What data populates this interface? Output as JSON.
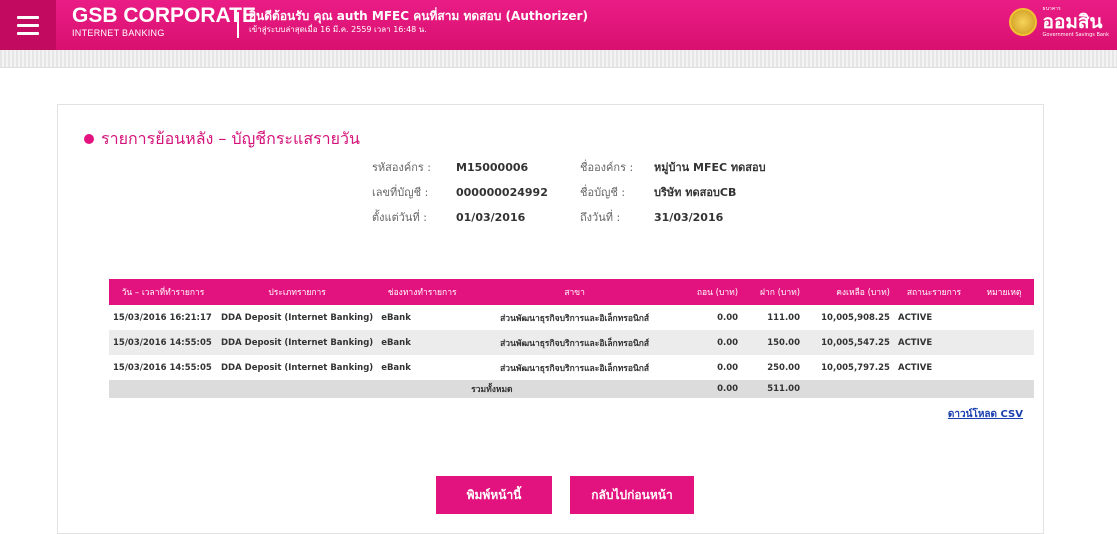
{
  "header": {
    "brand_main": "GSB CORPORATE",
    "brand_sub": "INTERNET BANKING",
    "welcome": "ยินดีต้อนรับ คุณ auth MFEC คนที่สาม ทดสอบ (Authorizer)",
    "last_login": "เข้าสู่ระบบล่าสุดเมื่อ 16 มี.ค. 2559 เวลา 16:48 น.",
    "bank_name": "ออมสิน",
    "bank_small_top": "ธนาคาร",
    "bank_small_bottom": "Government Savings Bank",
    "menu_icon": "hamburger-icon",
    "accent_color": "#e2127f"
  },
  "page": {
    "title": "รายการย้อนหลัง – บัญชีกระแสรายวัน"
  },
  "info": {
    "org_code_label": "รหัสองค์กร :",
    "org_code_value": "M15000006",
    "org_name_label": "ชื่อองค์กร :",
    "org_name_value": "หมู่บ้าน MFEC ทดสอบ",
    "account_no_label": "เลขที่บัญชี :",
    "account_no_value": "000000024992",
    "account_name_label": "ชื่อบัญชี :",
    "account_name_value": "บริษัท ทดสอบCB",
    "from_label": "ตั้งแต่วันที่ :",
    "from_value": "01/03/2016",
    "to_label": "ถึงวันที่ :",
    "to_value": "31/03/2016"
  },
  "table": {
    "headers": [
      "วัน – เวลาที่ทำรายการ",
      "ประเภทรายการ",
      "ช่องทางทำรายการ",
      "สาขา",
      "ถอน (บาท)",
      "ฝาก (บาท)",
      "คงเหลือ (บาท)",
      "สถานะรายการ",
      "หมายเหตุ"
    ],
    "rows": [
      [
        "15/03/2016 16:21:17",
        "DDA Deposit (Internet Banking)",
        "eBank",
        "ส่วนพัฒนาธุรกิจบริการและอิเล็กทรอนิกส์",
        "0.00",
        "111.00",
        "10,005,908.25",
        "ACTIVE",
        ""
      ],
      [
        "15/03/2016 14:55:05",
        "DDA Deposit (Internet Banking)",
        "eBank",
        "ส่วนพัฒนาธุรกิจบริการและอิเล็กทรอนิกส์",
        "0.00",
        "150.00",
        "10,005,547.25",
        "ACTIVE",
        ""
      ],
      [
        "15/03/2016 14:55:05",
        "DDA Deposit (Internet Banking)",
        "eBank",
        "ส่วนพัฒนาธุรกิจบริการและอิเล็กทรอนิกส์",
        "0.00",
        "250.00",
        "10,005,797.25",
        "ACTIVE",
        ""
      ]
    ],
    "total_label": "รวมทั้งหมด",
    "total_withdraw": "0.00",
    "total_deposit": "511.00"
  },
  "actions": {
    "download_csv": "ดาวน์โหลด CSV",
    "print": "พิมพ์หน้านี้",
    "back": "กลับไปก่อนหน้า"
  }
}
